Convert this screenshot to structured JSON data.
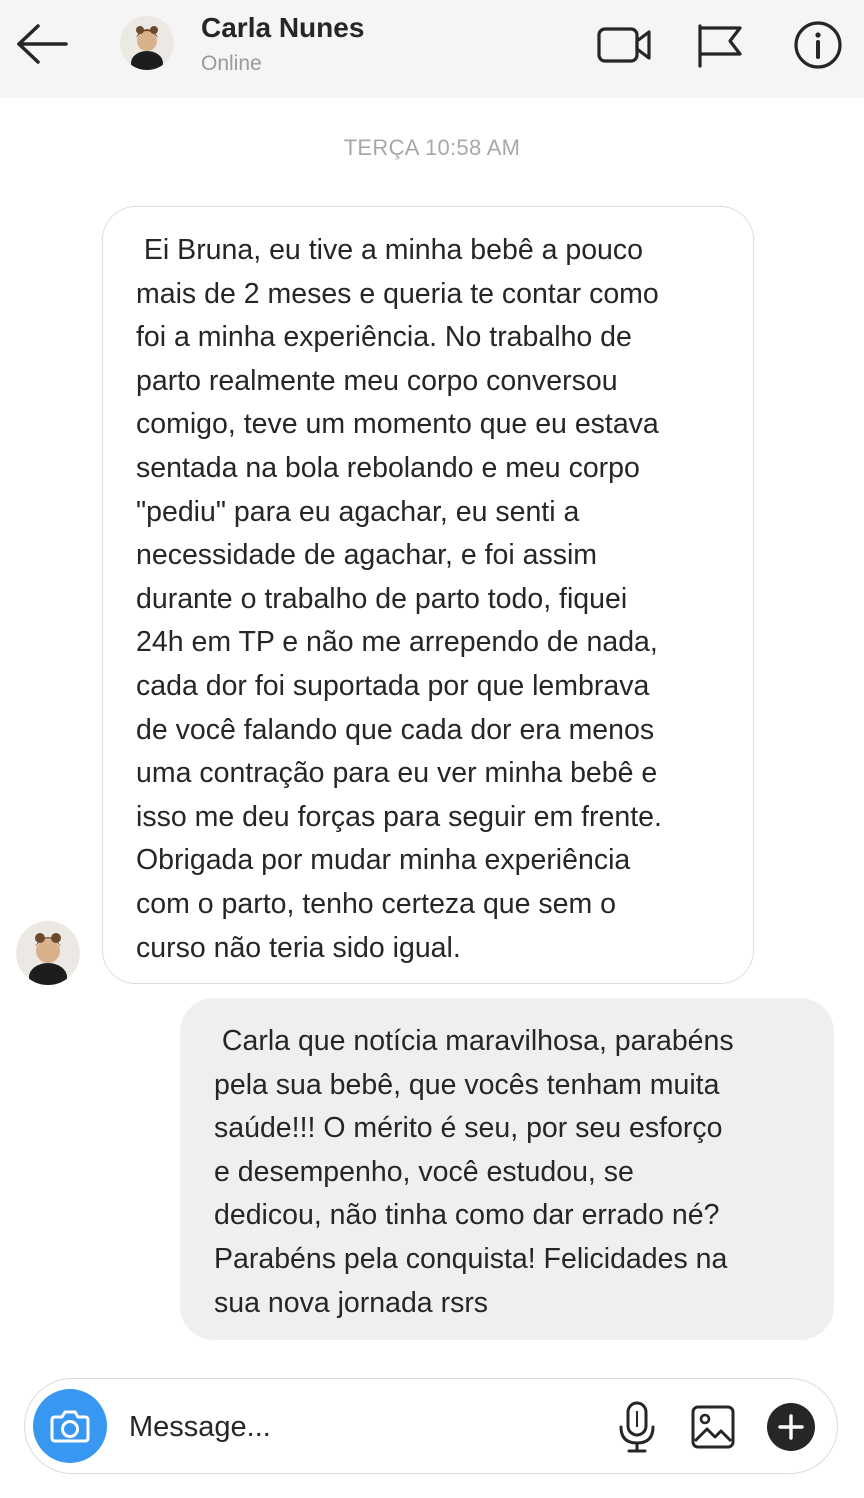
{
  "header": {
    "contact_name": "Carla Nunes",
    "status": "Online",
    "icons": {
      "back": "arrow-left-icon",
      "video": "video-camera-icon",
      "flag": "flag-icon",
      "info": "info-icon"
    }
  },
  "thread": {
    "timestamp": "TERÇA 10:58 AM",
    "messages": [
      {
        "direction": "incoming",
        "text": " Ei Bruna, eu tive a minha bebê a pouco\nmais de 2 meses e queria te contar como\nfoi a minha experiência. No trabalho de\nparto realmente meu corpo conversou\ncomigo, teve um momento que eu estava\nsentada na bola rebolando e meu corpo\n\"pediu\" para eu agachar, eu senti a\nnecessidade de agachar, e foi assim\ndurante o trabalho de parto todo, fiquei\n24h em TP e não me arrependo de nada,\ncada dor foi suportada por que lembrava\nde você falando que cada dor era menos\numa contração para eu ver minha bebê e\nisso me deu forças para seguir em frente.\nObrigada por mudar minha experiência\ncom o parto, tenho certeza que sem o\ncurso não teria sido igual."
      },
      {
        "direction": "outgoing",
        "text": " Carla que notícia maravilhosa, parabéns\npela sua bebê, que vocês tenham muita\nsaúde!!! O mérito é seu, por seu esforço\ne desempenho, você estudou, se\ndedicou, não tinha como dar errado né?\nParabéns pela conquista! Felicidades na\nsua nova jornada rsrs"
      }
    ]
  },
  "composer": {
    "placeholder": "Message...",
    "value": "",
    "icons": {
      "camera": "camera-icon",
      "mic": "microphone-icon",
      "gallery": "image-icon",
      "plus": "plus-circle-icon"
    }
  },
  "colors": {
    "accent": "#3897f0",
    "header_bg": "#f5f5f5",
    "outgoing_bubble": "#efefef",
    "muted_text": "#9a9a9a"
  }
}
